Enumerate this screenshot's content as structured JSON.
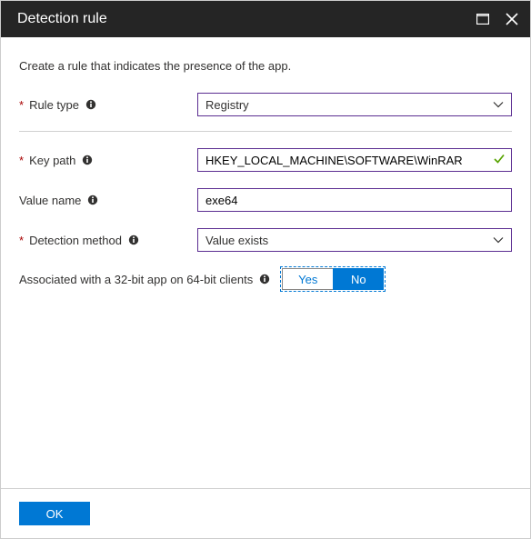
{
  "header": {
    "title": "Detection rule"
  },
  "description": "Create a rule that indicates the presence of the app.",
  "fields": {
    "ruleType": {
      "label": "Rule type",
      "value": "Registry"
    },
    "keyPath": {
      "label": "Key path",
      "value": "HKEY_LOCAL_MACHINE\\SOFTWARE\\WinRAR"
    },
    "valueName": {
      "label": "Value name",
      "value": "exe64"
    },
    "detectionMethod": {
      "label": "Detection method",
      "value": "Value exists"
    },
    "associated32bit": {
      "label": "Associated with a 32-bit app on 64-bit clients",
      "yes": "Yes",
      "no": "No",
      "selected": "No"
    }
  },
  "footer": {
    "ok": "OK"
  }
}
